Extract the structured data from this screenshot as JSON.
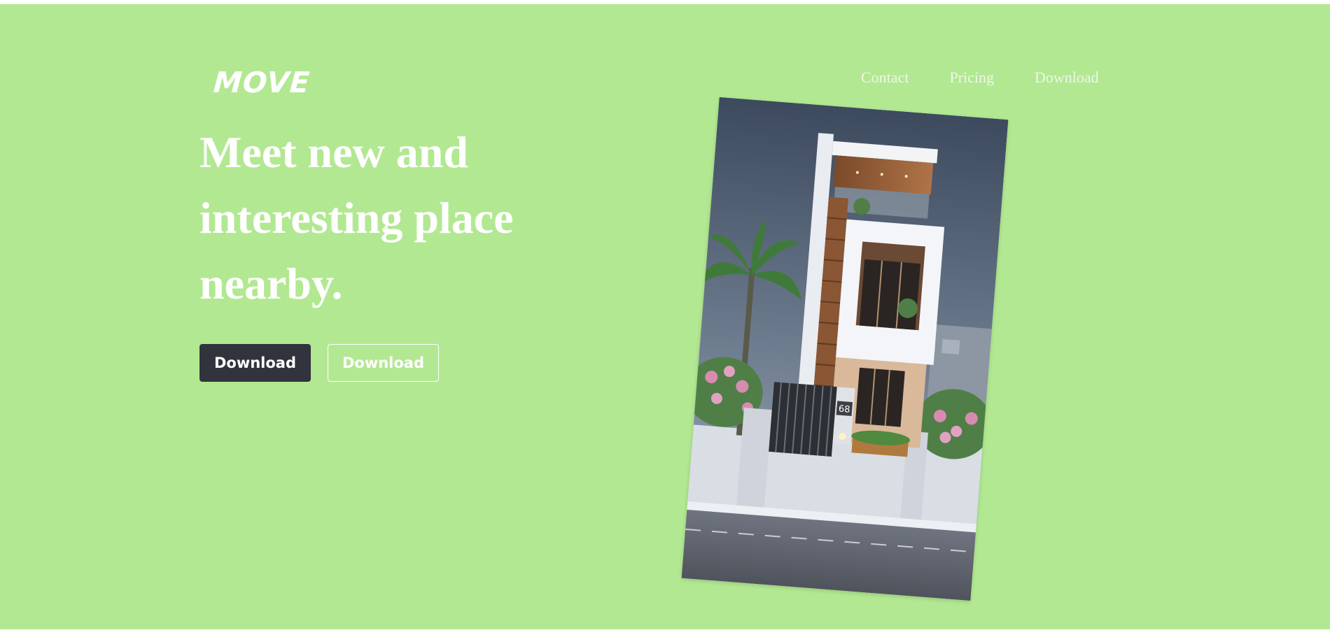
{
  "brand": {
    "logo": "MOVE"
  },
  "nav": {
    "items": [
      {
        "label": "Contact"
      },
      {
        "label": "Pricing"
      },
      {
        "label": "Download"
      }
    ]
  },
  "hero": {
    "headline_lines": [
      "Meet new and",
      "interesting place",
      "nearby."
    ],
    "primary_button": "Download",
    "secondary_button": "Download"
  },
  "image": {
    "house_number": "68"
  },
  "colors": {
    "background": "#b2e892",
    "primary_button": "#31343d",
    "text": "#ffffff"
  }
}
